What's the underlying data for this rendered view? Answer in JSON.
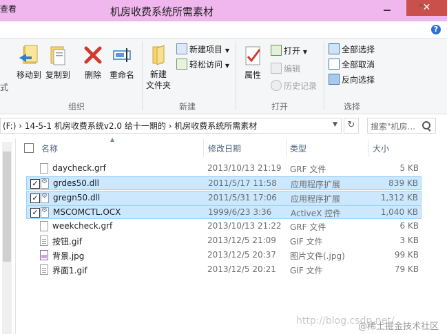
{
  "window": {
    "title": "机房收费系统所需素材",
    "close_glyph": "✕"
  },
  "menubar": {
    "view_tab": "查看",
    "ribbon_toggle": "^",
    "help": "?"
  },
  "ribbon": {
    "left_cut_label": "式",
    "groups": {
      "organize": {
        "label": "组织",
        "move_to": "移动到",
        "copy_to": "复制到",
        "delete": "删除",
        "rename": "重命名"
      },
      "new": {
        "label": "新建",
        "new_item": "新建项目",
        "easy_access": "轻松访问",
        "new_folder": "新建\n文件夹"
      },
      "open": {
        "label": "打开",
        "properties": "属性",
        "open": "打开",
        "edit": "编辑",
        "history": "历史记录"
      },
      "select": {
        "label": "选择",
        "select_all": "全部选择",
        "select_none": "全部取消",
        "invert": "反向选择"
      }
    }
  },
  "address": {
    "path": "(F:)  ›  14-5-1 机房收费系统v2.0 给十一期的  ›  机房收费系统所需素材",
    "search_placeholder": "搜索\"机房...",
    "refresh_glyph": "↻",
    "dropdown_glyph": "▼"
  },
  "columns": {
    "name": "名称",
    "modified": "修改日期",
    "type": "类型",
    "size": "大小"
  },
  "files": [
    {
      "name": "daycheck.grf",
      "modified": "2013/10/13 21:19",
      "type": "GRF 文件",
      "size": "5 KB",
      "selected": false,
      "icon": "file"
    },
    {
      "name": "grdes50.dll",
      "modified": "2011/5/17 11:58",
      "type": "应用程序扩展",
      "size": "839 KB",
      "selected": true,
      "icon": "dll"
    },
    {
      "name": "gregn50.dll",
      "modified": "2011/5/31 17:06",
      "type": "应用程序扩展",
      "size": "1,312 KB",
      "selected": true,
      "icon": "dll"
    },
    {
      "name": "MSCOMCTL.OCX",
      "modified": "1999/6/23 3:36",
      "type": "ActiveX 控件",
      "size": "1,040 KB",
      "selected": true,
      "icon": "dll"
    },
    {
      "name": "weekcheck.grf",
      "modified": "2013/10/13 21:22",
      "type": "GRF 文件",
      "size": "6 KB",
      "selected": false,
      "icon": "file"
    },
    {
      "name": "按钮.gif",
      "modified": "2013/12/5 21:09",
      "type": "GIF 文件",
      "size": "3 KB",
      "selected": false,
      "icon": "gif"
    },
    {
      "name": "背景.jpg",
      "modified": "2013/12/5 20:37",
      "type": "图片文件(.jpg)",
      "size": "99 KB",
      "selected": false,
      "icon": "img"
    },
    {
      "name": "界面1.gif",
      "modified": "2013/12/5 20:21",
      "type": "GIF 文件",
      "size": "79 KB",
      "selected": false,
      "icon": "gif"
    }
  ],
  "checkmark": "✓",
  "watermark": {
    "url_text": "http://blog.csdn.net/",
    "community": "@稀土掘金技术社区"
  },
  "colors": {
    "titlebar": "#f0b6ee",
    "close_button": "#c9504b",
    "selection": "#cce8ff",
    "selection_border": "#99d1ff"
  }
}
